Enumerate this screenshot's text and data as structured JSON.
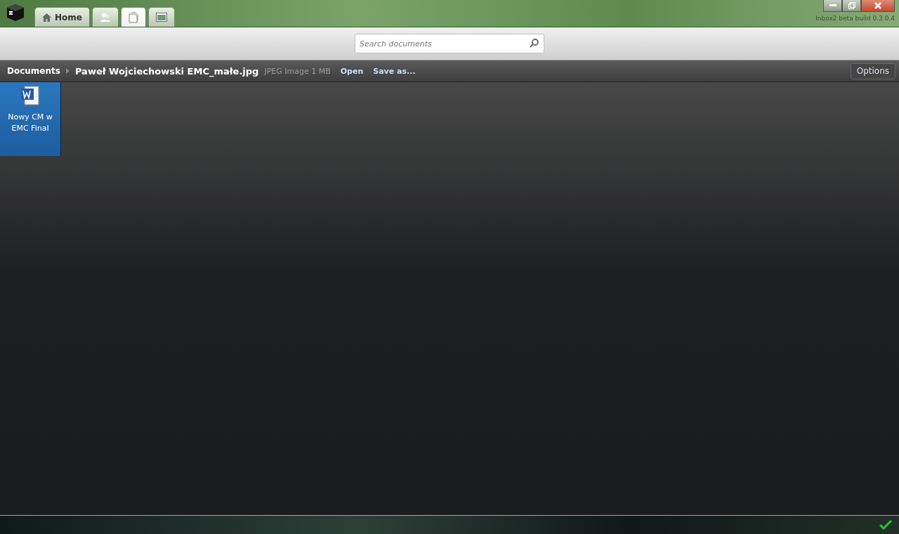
{
  "tabs": [
    {
      "kind": "home",
      "label": "Home",
      "selected": false
    },
    {
      "kind": "contacts",
      "selected": false
    },
    {
      "kind": "documents",
      "selected": true
    },
    {
      "kind": "images",
      "selected": false
    }
  ],
  "build": "Inbox2 beta build 0.3.0.4",
  "search": {
    "placeholder": "Search documents"
  },
  "breadcrumb": {
    "root": "Documents",
    "file": "Paweł Wojciechowski EMC_małe.jpg",
    "info": "JPEG Image 1 MB",
    "actions": [
      "Open",
      "Save as..."
    ],
    "options": "Options"
  },
  "documents": [
    {
      "name": "Nowy CM w EMC Final",
      "selected": true
    }
  ]
}
